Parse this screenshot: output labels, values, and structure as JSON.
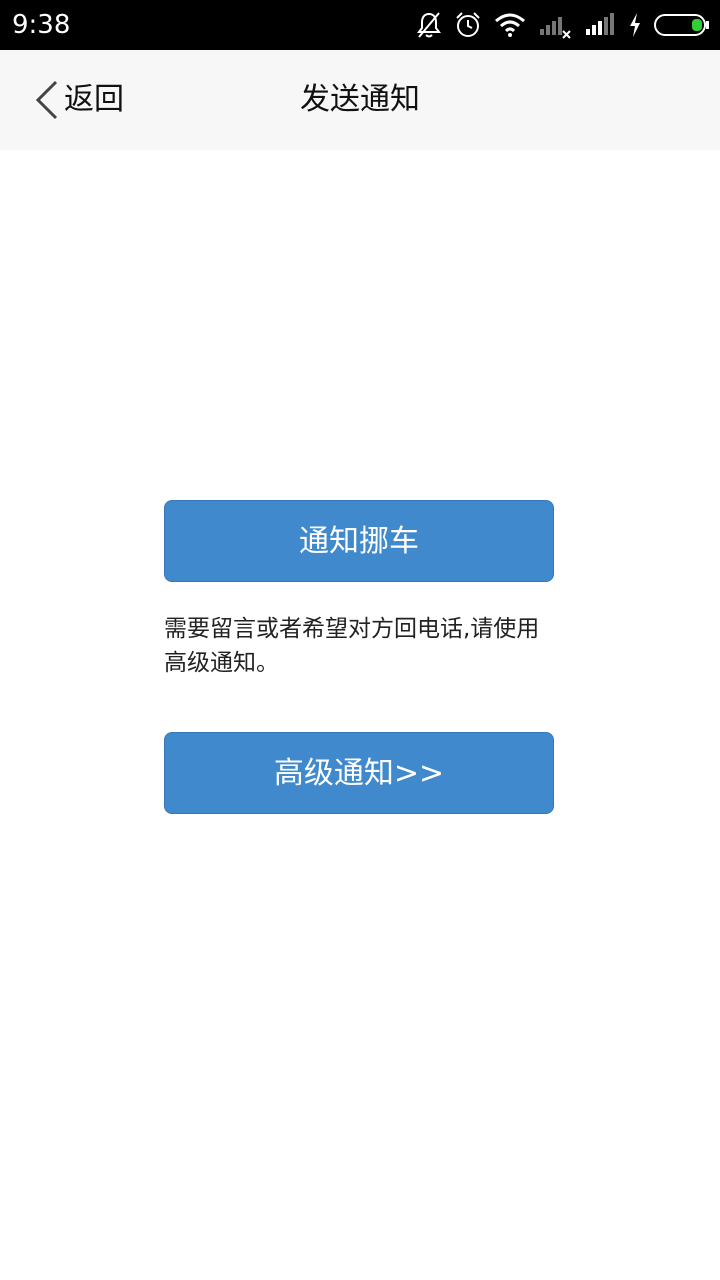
{
  "status_bar": {
    "time": "9:38",
    "icons": [
      "bell-off-icon",
      "alarm-icon",
      "wifi-icon",
      "signal-no-service-icon",
      "signal-icon",
      "charging-icon",
      "battery-icon"
    ],
    "battery_color": "#33cc33"
  },
  "nav": {
    "back_label": "返回",
    "title": "发送通知"
  },
  "main": {
    "move_car_button": "通知挪车",
    "hint": "需要留言或者希望对方回电话,请使用高级通知。",
    "advanced_button": "高级通知>>"
  },
  "colors": {
    "button_blue": "#3f89cc",
    "nav_bg": "#f7f7f7",
    "status_bg": "#000000"
  }
}
